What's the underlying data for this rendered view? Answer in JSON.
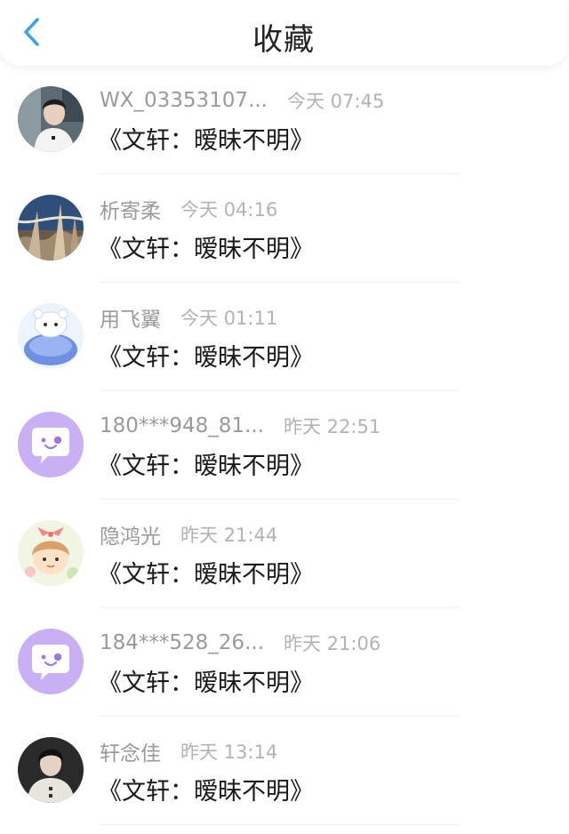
{
  "header": {
    "title": "收藏",
    "back_icon": "chevron-left-icon",
    "accent_color": "#3c9ff0"
  },
  "items": [
    {
      "name": "WX_03353107...",
      "time": "今天 07:45",
      "content": "《文轩：暧昧不明》",
      "avatar": "photo-boy-white-shirt"
    },
    {
      "name": "析寄柔",
      "time": "今天 04:16",
      "content": "《文轩：暧昧不明》",
      "avatar": "photo-winter-landscape"
    },
    {
      "name": "用飞翼",
      "time": "今天 01:11",
      "content": "《文轩：暧昧不明》",
      "avatar": "cartoon-blue-bear"
    },
    {
      "name": "180***948_81...",
      "time": "昨天 22:51",
      "content": "《文轩：暧昧不明》",
      "avatar": "default-purple-chat-bubble"
    },
    {
      "name": "隐鸿光",
      "time": "昨天 21:44",
      "content": "《文轩：暧昧不明》",
      "avatar": "cartoon-girl-bow"
    },
    {
      "name": "184***528_26...",
      "time": "昨天 21:06",
      "content": "《文轩：暧昧不明》",
      "avatar": "default-purple-chat-bubble"
    },
    {
      "name": "轩念佳",
      "time": "昨天 13:14",
      "content": "《文轩：暧昧不明》",
      "avatar": "photo-boy-dark-background"
    }
  ]
}
